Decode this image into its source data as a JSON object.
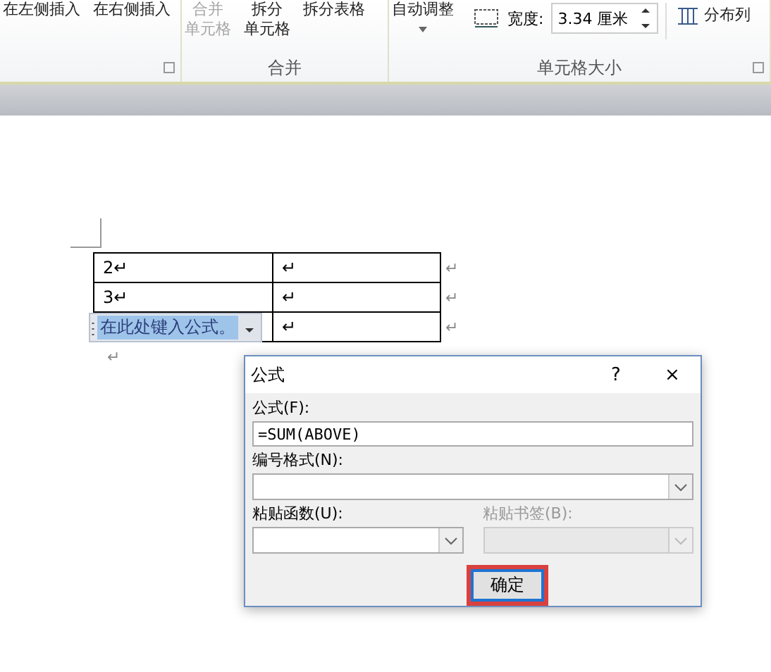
{
  "ribbon": {
    "insert_buttons": [
      "在左侧插入",
      "在右侧插入"
    ],
    "merge_group": {
      "label": "合并",
      "buttons": [
        {
          "lines": [
            "合并",
            "单元格"
          ],
          "disabled": true
        },
        {
          "lines": [
            "拆分",
            "单元格"
          ],
          "disabled": false
        },
        {
          "lines": [
            "拆分表格"
          ],
          "disabled": false
        }
      ]
    },
    "size_group": {
      "label": "单元格大小",
      "autofit": "自动调整",
      "width_label": "宽度:",
      "width_value": "3.34 厘米",
      "distribute": "分布列"
    }
  },
  "document": {
    "rows": [
      {
        "cells": [
          {
            "kind": "text",
            "text": "2↵"
          },
          {
            "kind": "text",
            "text": "↵"
          }
        ],
        "end_mark": "↵"
      },
      {
        "cells": [
          {
            "kind": "text",
            "text": "3↵"
          },
          {
            "kind": "text",
            "text": "↵"
          }
        ],
        "end_mark": "↵"
      },
      {
        "cells": [
          {
            "kind": "formula_field",
            "text": "在此处键入公式。"
          },
          {
            "kind": "text",
            "text": "↵"
          }
        ],
        "end_mark": "↵"
      }
    ],
    "paragraph_mark": "↵"
  },
  "dialog": {
    "title": "公式",
    "help": "?",
    "close": "×",
    "formula_label": "公式(F):",
    "formula_value": "=SUM(ABOVE)",
    "number_format_label": "编号格式(N):",
    "paste_function_label": "粘贴函数(U):",
    "paste_bookmark_label": "粘贴书签(B):",
    "paste_bookmark_disabled": true,
    "ok_button": "确定",
    "ok_highlighted": true
  }
}
